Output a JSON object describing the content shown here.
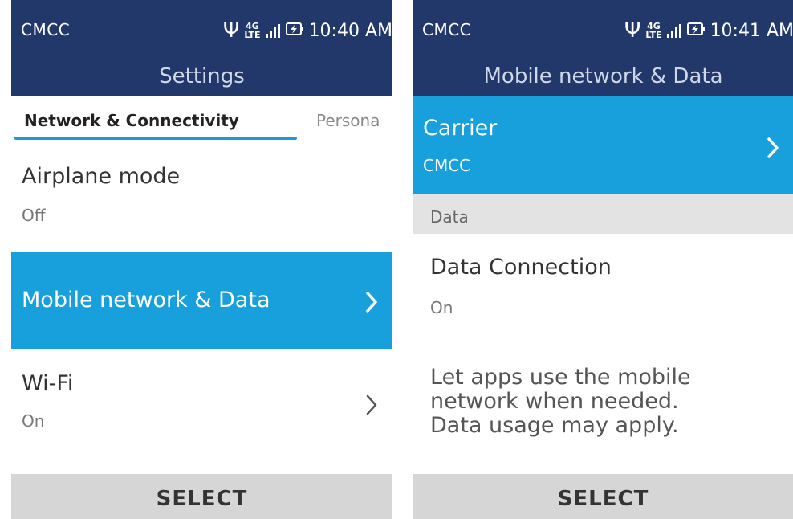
{
  "left_screen": {
    "status": {
      "carrier": "CMCC",
      "network": "4G",
      "network_sub": "LTE",
      "time": "10:40 AM"
    },
    "header": {
      "title": "Settings"
    },
    "tabs": {
      "active": "Network & Connectivity",
      "next": "Persona"
    },
    "items": [
      {
        "label": "Airplane mode",
        "value": "Off",
        "selected": false
      },
      {
        "label": "Mobile network & Data",
        "value": "",
        "selected": true
      },
      {
        "label": "Wi-Fi",
        "value": "On",
        "selected": false
      }
    ],
    "softkey": {
      "center": "SELECT"
    }
  },
  "right_screen": {
    "status": {
      "carrier": "CMCC",
      "network": "4G",
      "network_sub": "LTE",
      "time": "10:41 AM"
    },
    "header": {
      "title": "Mobile network & Data"
    },
    "carrier_item": {
      "label": "Carrier",
      "value": "CMCC",
      "selected": true
    },
    "section": {
      "title": "Data"
    },
    "data_item": {
      "label": "Data Connection",
      "value": "On"
    },
    "description": [
      "Let apps use the mobile",
      "network when needed.",
      "Data usage may apply."
    ],
    "softkey": {
      "center": "SELECT"
    }
  },
  "colors": {
    "statusbar": "#22386b",
    "accent": "#17a0dc",
    "softkey_bar": "#d6d6d6"
  },
  "icons": [
    "usb-icon",
    "lte-icon",
    "signal-icon",
    "battery-charging-icon",
    "chevron-right-icon"
  ]
}
